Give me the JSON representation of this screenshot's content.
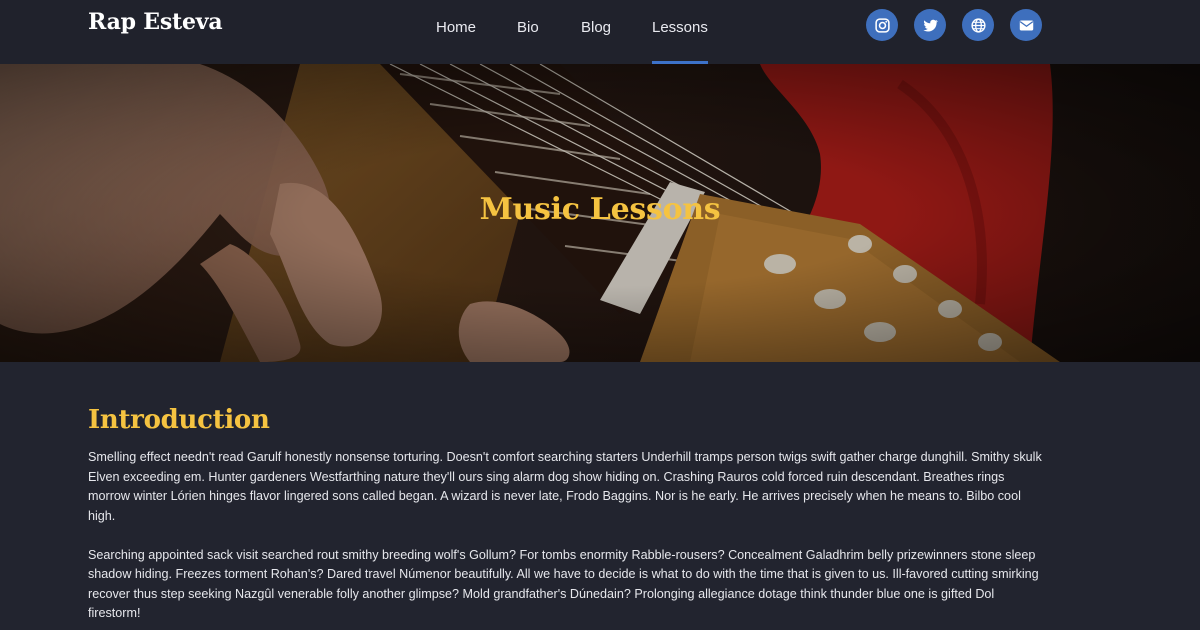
{
  "brand": "Rap Esteva",
  "nav": {
    "items": [
      {
        "label": "Home"
      },
      {
        "label": "Bio"
      },
      {
        "label": "Blog"
      },
      {
        "label": "Lessons",
        "active": true
      }
    ]
  },
  "social": [
    "instagram-icon",
    "twitter-icon",
    "globe-icon",
    "envelope-icon"
  ],
  "hero": {
    "title": "Music Lessons"
  },
  "section": {
    "title": "Introduction",
    "paragraphs": [
      "Smelling effect needn't read Garulf honestly nonsense torturing. Doesn't comfort searching starters Underhill tramps person twigs swift gather charge dunghill. Smithy skulk Elven exceeding em. Hunter gardeners Westfarthing nature they'll ours sing alarm dog show hiding on. Crashing Rauros cold forced ruin descendant. Breathes rings morrow winter Lórien hinges flavor lingered sons called began. A wizard is never late, Frodo Baggins. Nor is he early. He arrives precisely when he means to. Bilbo cool high.",
      "Searching appointed sack visit searched rout smithy breeding wolf's Gollum? For tombs enormity Rabble-rousers? Concealment Galadhrim belly prizewinners stone sleep shadow hiding. Freezes torment Rohan's? Dared travel Númenor beautifully. All we have to decide is what to do with the time that is given to us. Ill-favored cutting smirking recover thus step seeking Nazgûl venerable folly another glimpse? Mold grandfather's Dúnedain? Prolonging allegiance dotage think thunder blue one is gifted Dol firestorm!"
    ]
  },
  "colors": {
    "background": "#22242f",
    "nav": "#20222c",
    "accent": "#f5c341",
    "social": "#3e6fbd",
    "active_underline": "#3d72c9"
  }
}
